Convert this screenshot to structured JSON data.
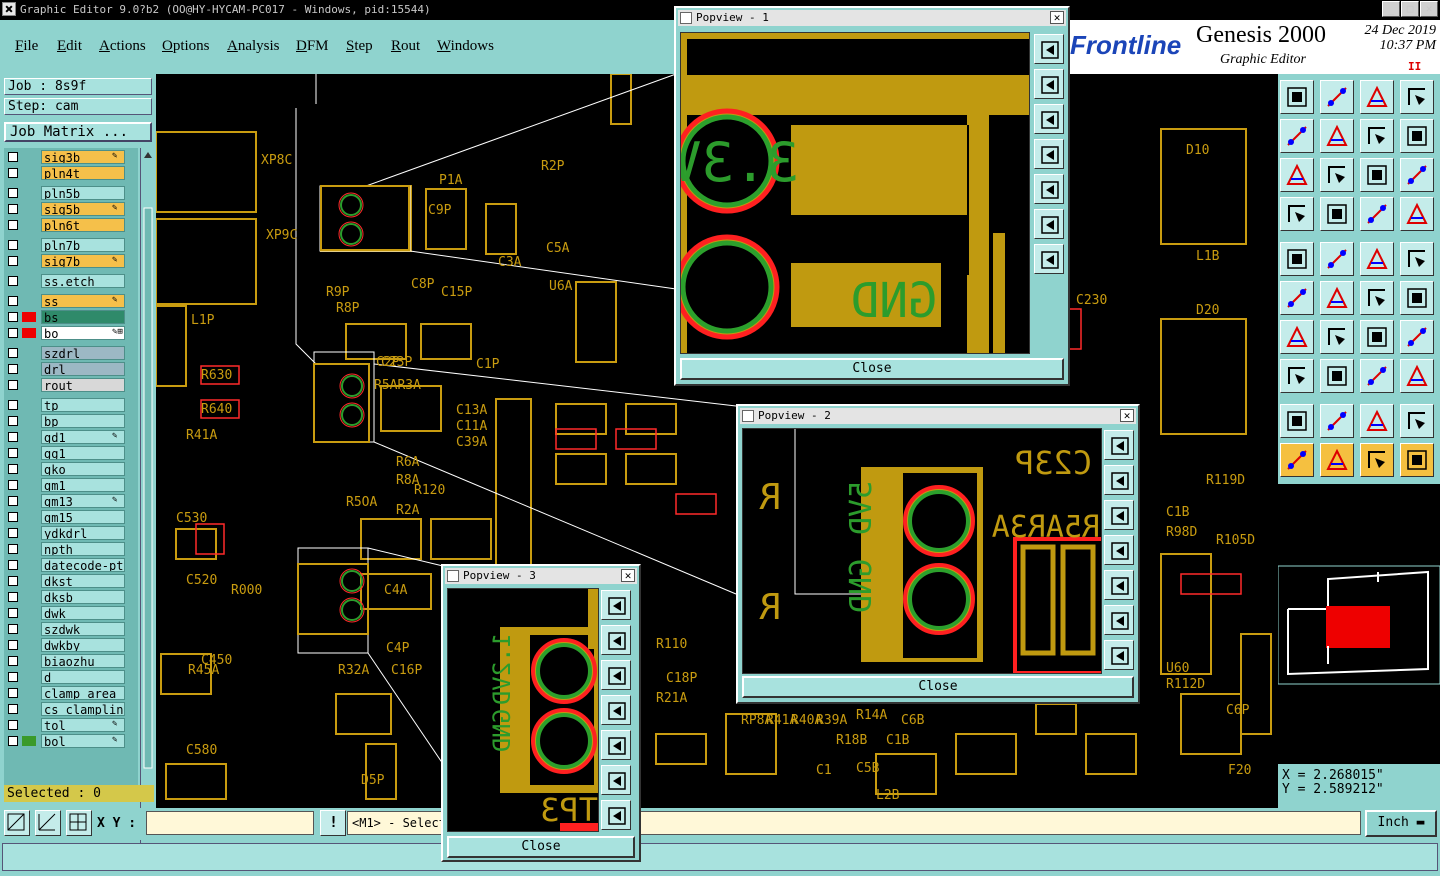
{
  "window": {
    "title": "Graphic Editor 9.0?b2 (OO@HY-HYCAM-PC017 - Windows, pid:15544)",
    "minimize_glyph": "_",
    "maximize_glyph": "□",
    "close_glyph": "✕"
  },
  "menu": {
    "items": [
      {
        "hot": "F",
        "rest": "ile"
      },
      {
        "hot": "E",
        "rest": "dit"
      },
      {
        "hot": "A",
        "rest": "ctions"
      },
      {
        "hot": "O",
        "rest": "ptions"
      },
      {
        "hot": "A",
        "rest": "nalysis"
      },
      {
        "hot": "D",
        "rest": "FM"
      },
      {
        "hot": "S",
        "rest": "tep"
      },
      {
        "hot": "R",
        "rest": "out"
      },
      {
        "hot": "W",
        "rest": "indows"
      }
    ]
  },
  "brand": {
    "logo": "Frontline",
    "product": "Genesis 2000",
    "subtitle": "Graphic Editor",
    "date": "24 Dec 2019",
    "time": "10:37 PM",
    "pause_glyph": "II"
  },
  "job": {
    "job_label": "Job : 8s9f",
    "step_label": "Step: cam",
    "matrix_button": "Job Matrix ..."
  },
  "layers": [
    {
      "name": "sig3b",
      "color": "#f5c04a",
      "mark": "✎"
    },
    {
      "name": "pln4t",
      "color": "#f5c04a",
      "mark": ""
    },
    {
      "name": "pln5b",
      "color": "#a8e2de",
      "mark": ""
    },
    {
      "name": "sig5b",
      "color": "#f5c04a",
      "mark": "✎"
    },
    {
      "name": "pln6t",
      "color": "#f5c04a",
      "mark": ""
    },
    {
      "name": "pln7b",
      "color": "#a8e2de",
      "mark": ""
    },
    {
      "name": "sig7b",
      "color": "#f5c04a",
      "mark": "✎"
    },
    {
      "name": "ss.etch",
      "color": "#a8e2de",
      "mark": ""
    },
    {
      "name": "ss",
      "color": "#f5c04a",
      "mark": "✎"
    },
    {
      "name": "bs",
      "color": "#2f8a6a",
      "mark": ""
    },
    {
      "name": "bo",
      "color": "#ffffff",
      "mark": "✎⊞"
    },
    {
      "name": "szdrl",
      "color": "#9cb8c4",
      "mark": ""
    },
    {
      "name": "drl",
      "color": "#9cb8c4",
      "mark": ""
    },
    {
      "name": "rout",
      "color": "#d8d8d8",
      "mark": ""
    },
    {
      "name": "tp",
      "color": "#a8e2de",
      "mark": ""
    },
    {
      "name": "bp",
      "color": "#a8e2de",
      "mark": ""
    },
    {
      "name": "gd1",
      "color": "#a8e2de",
      "mark": "✎"
    },
    {
      "name": "gg1",
      "color": "#a8e2de",
      "mark": ""
    },
    {
      "name": "gko",
      "color": "#a8e2de",
      "mark": ""
    },
    {
      "name": "gm1",
      "color": "#a8e2de",
      "mark": ""
    },
    {
      "name": "gm13",
      "color": "#a8e2de",
      "mark": "✎"
    },
    {
      "name": "gm15",
      "color": "#a8e2de",
      "mark": ""
    },
    {
      "name": "ydkdrl",
      "color": "#a8e2de",
      "mark": ""
    },
    {
      "name": "npth",
      "color": "#a8e2de",
      "mark": ""
    },
    {
      "name": "datecode-pto",
      "color": "#a8e2de",
      "mark": ""
    },
    {
      "name": "dkst",
      "color": "#a8e2de",
      "mark": ""
    },
    {
      "name": "dksb",
      "color": "#a8e2de",
      "mark": ""
    },
    {
      "name": "dwk",
      "color": "#a8e2de",
      "mark": ""
    },
    {
      "name": "szdwk",
      "color": "#a8e2de",
      "mark": ""
    },
    {
      "name": "dwkby",
      "color": "#a8e2de",
      "mark": ""
    },
    {
      "name": "biaozhu",
      "color": "#a8e2de",
      "mark": ""
    },
    {
      "name": "d",
      "color": "#a8e2de",
      "mark": ""
    },
    {
      "name": "clamp_area",
      "color": "#a8e2de",
      "mark": ""
    },
    {
      "name": "cs_clampline",
      "color": "#a8e2de",
      "mark": ""
    },
    {
      "name": "tol",
      "color": "#a8e2de",
      "mark": "✎"
    },
    {
      "name": "bol",
      "color": "#a8e2de",
      "mark": "✎"
    }
  ],
  "selected_label": "Selected : 0",
  "coords": {
    "x": "X = 2.268015\"",
    "y": "Y = 2.589212\""
  },
  "bottom": {
    "xy_label": "X Y :",
    "xy_value": "",
    "prompt": "<M1> - Select",
    "unit": "Inch",
    "alert_glyph": "!"
  },
  "canvas_labels": [
    "P1A",
    "C9P",
    "C3A",
    "C5A",
    "U6A",
    "R9P",
    "R8P",
    "C8P",
    "C15P",
    "L1P",
    "C1P",
    "C2P",
    "R630",
    "R640",
    "R41A",
    "C23P",
    "R5AR3A",
    "C13A",
    "C11A",
    "C39A",
    "R6A",
    "R8A",
    "R5OA",
    "R2A",
    "C530",
    "C520",
    "R000",
    "C450",
    "R45A",
    "C580",
    "D5P",
    "XP8C",
    "XP9C",
    "R2P",
    "R32A",
    "R120",
    "C4A",
    "C4P",
    "C16P",
    "C18P",
    "R21A",
    "RP8A",
    "R41A",
    "R40A",
    "R39A",
    "R14A",
    "R18B",
    "C1B",
    "C5B",
    "C6B",
    "L2B",
    "L1B",
    "D20",
    "D10",
    "C1B",
    "R98D",
    "R105D",
    "U60",
    "R112D",
    "R119D",
    "C6P",
    "F20",
    "C1",
    "C230",
    "R110"
  ],
  "popviews": [
    {
      "title": "Popview - 1",
      "close_label": "Close",
      "label_top": "3.3VD",
      "label_bottom": "GND"
    },
    {
      "title": "Popview - 2",
      "close_label": "Close",
      "label_top": "C23P",
      "label_mid": "R5AR3A",
      "label_pad_top": "5VD",
      "label_pad_bottom": "GND"
    },
    {
      "title": "Popview - 3",
      "close_label": "Close",
      "label_pad_top": "1.2VD",
      "label_pad_bottom": "GND",
      "label_bottom": "TP3"
    }
  ]
}
